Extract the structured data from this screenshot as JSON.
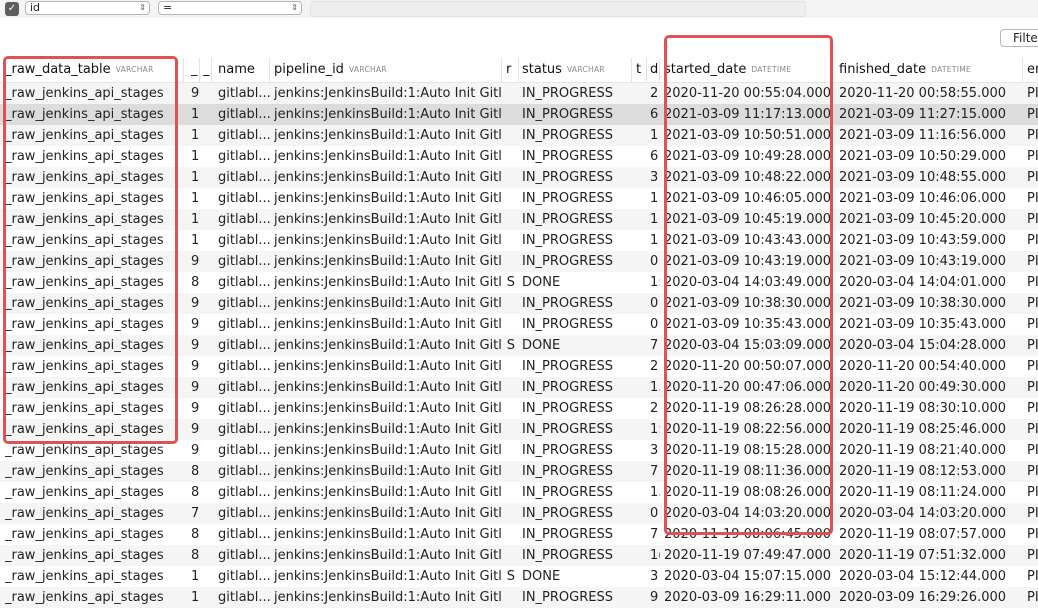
{
  "filter": {
    "field": "id",
    "operator": "=",
    "value": "",
    "filter_button": "Filter",
    "enabled_icon": "checkmark-icon"
  },
  "table": {
    "columns": [
      {
        "name": "_raw_data_table",
        "type": "VARCHAR"
      },
      {
        "name": "_",
        "type": ""
      },
      {
        "name": "_",
        "type": ""
      },
      {
        "name": "name",
        "type": ""
      },
      {
        "name": "pipeline_id",
        "type": "VARCHAR"
      },
      {
        "name": "r",
        "type": ""
      },
      {
        "name": "status",
        "type": "VARCHAR"
      },
      {
        "name": "t",
        "type": ""
      },
      {
        "name": "d",
        "type": ""
      },
      {
        "name": "started_date",
        "type": "DATETIME"
      },
      {
        "name": "finished_date",
        "type": "DATETIME"
      },
      {
        "name": "er",
        "type": ""
      }
    ],
    "selected_row": 1,
    "rows": [
      [
        "_raw_jenkins_api_stages",
        "9",
        "",
        "gitlabl...",
        "jenkins:JenkinsBuild:1:Auto Init Gitl...",
        "",
        "IN_PROGRESS",
        "",
        "2",
        "2020-11-20 00:55:04.000",
        "2020-11-20 00:58:55.000",
        "PI"
      ],
      [
        "_raw_jenkins_api_stages",
        "1(",
        "",
        "gitlabl...",
        "jenkins:JenkinsBuild:1:Auto Init Gitl...",
        "",
        "IN_PROGRESS",
        "",
        "6",
        "2021-03-09 11:17:13.000",
        "2021-03-09 11:27:15.000",
        "PI"
      ],
      [
        "_raw_jenkins_api_stages",
        "1(",
        "",
        "gitlabl...",
        "jenkins:JenkinsBuild:1:Auto Init Gitl...",
        "",
        "IN_PROGRESS",
        "",
        "1!",
        "2021-03-09 10:50:51.000",
        "2021-03-09 11:16:56.000",
        "PI"
      ],
      [
        "_raw_jenkins_api_stages",
        "1(",
        "",
        "gitlabl...",
        "jenkins:JenkinsBuild:1:Auto Init Gitl...",
        "",
        "IN_PROGRESS",
        "",
        "6",
        "2021-03-09 10:49:28.000",
        "2021-03-09 10:50:29.000",
        "PI"
      ],
      [
        "_raw_jenkins_api_stages",
        "1(",
        "",
        "gitlabl...",
        "jenkins:JenkinsBuild:1:Auto Init Gitl...",
        "",
        "IN_PROGRESS",
        "",
        "3",
        "2021-03-09 10:48:22.000",
        "2021-03-09 10:48:55.000",
        "PI"
      ],
      [
        "_raw_jenkins_api_stages",
        "1(",
        "",
        "gitlabl...",
        "jenkins:JenkinsBuild:1:Auto Init Gitl...",
        "",
        "IN_PROGRESS",
        "",
        "1",
        "2021-03-09 10:46:05.000",
        "2021-03-09 10:46:06.000",
        "PI"
      ],
      [
        "_raw_jenkins_api_stages",
        "1(",
        "",
        "gitlabl...",
        "jenkins:JenkinsBuild:1:Auto Init Gitl...",
        "",
        "IN_PROGRESS",
        "",
        "1",
        "2021-03-09 10:45:19.000",
        "2021-03-09 10:45:20.000",
        "PI"
      ],
      [
        "_raw_jenkins_api_stages",
        "1(",
        "",
        "gitlabl...",
        "jenkins:JenkinsBuild:1:Auto Init Gitl...",
        "",
        "IN_PROGRESS",
        "",
        "1",
        "2021-03-09 10:43:43.000",
        "2021-03-09 10:43:59.000",
        "PI"
      ],
      [
        "_raw_jenkins_api_stages",
        "9",
        "",
        "gitlabl...",
        "jenkins:JenkinsBuild:1:Auto Init Gitl...",
        "",
        "IN_PROGRESS",
        "",
        "0",
        "2021-03-09 10:43:19.000",
        "2021-03-09 10:43:19.000",
        "PI"
      ],
      [
        "_raw_jenkins_api_stages",
        "8",
        "",
        "gitlabl...",
        "jenkins:JenkinsBuild:1:Auto Init Gitl...",
        "S",
        "DONE",
        "",
        "1:",
        "2020-03-04 14:03:49.000",
        "2020-03-04 14:04:01.000",
        "PI"
      ],
      [
        "_raw_jenkins_api_stages",
        "9",
        "",
        "gitlabl...",
        "jenkins:JenkinsBuild:1:Auto Init Gitl...",
        "",
        "IN_PROGRESS",
        "",
        "0",
        "2021-03-09 10:38:30.000",
        "2021-03-09 10:38:30.000",
        "PI"
      ],
      [
        "_raw_jenkins_api_stages",
        "9",
        "",
        "gitlabl...",
        "jenkins:JenkinsBuild:1:Auto Init Gitl...",
        "",
        "IN_PROGRESS",
        "",
        "0",
        "2021-03-09 10:35:43.000",
        "2021-03-09 10:35:43.000",
        "PI"
      ],
      [
        "_raw_jenkins_api_stages",
        "9",
        "",
        "gitlabl...",
        "jenkins:JenkinsBuild:1:Auto Init Gitl...",
        "S",
        "DONE",
        "",
        "7",
        "2020-03-04 15:03:09.000",
        "2020-03-04 15:04:28.000",
        "PI"
      ],
      [
        "_raw_jenkins_api_stages",
        "9",
        "",
        "gitlabl...",
        "jenkins:JenkinsBuild:1:Auto Init Gitl...",
        "",
        "IN_PROGRESS",
        "",
        "2",
        "2020-11-20 00:50:07.000",
        "2020-11-20 00:54:40.000",
        "PI"
      ],
      [
        "_raw_jenkins_api_stages",
        "9",
        "",
        "gitlabl...",
        "jenkins:JenkinsBuild:1:Auto Init Gitl...",
        "",
        "IN_PROGRESS",
        "",
        "1.",
        "2020-11-20 00:47:06.000",
        "2020-11-20 00:49:30.000",
        "PI"
      ],
      [
        "_raw_jenkins_api_stages",
        "9",
        "",
        "gitlabl...",
        "jenkins:JenkinsBuild:1:Auto Init Gitl...",
        "",
        "IN_PROGRESS",
        "",
        "2",
        "2020-11-19 08:26:28.000",
        "2020-11-19 08:30:10.000",
        "PI"
      ],
      [
        "_raw_jenkins_api_stages",
        "9",
        "",
        "gitlabl...",
        "jenkins:JenkinsBuild:1:Auto Init Gitl...",
        "",
        "IN_PROGRESS",
        "",
        "1:",
        "2020-11-19 08:22:56.000",
        "2020-11-19 08:25:46.000",
        "PI"
      ],
      [
        "_raw_jenkins_api_stages",
        "9",
        "",
        "gitlabl...",
        "jenkins:JenkinsBuild:1:Auto Init Gitl...",
        "",
        "IN_PROGRESS",
        "",
        "3",
        "2020-11-19 08:15:28.000",
        "2020-11-19 08:21:40.000",
        "PI"
      ],
      [
        "_raw_jenkins_api_stages",
        "8",
        "",
        "gitlabl...",
        "jenkins:JenkinsBuild:1:Auto Init Gitl...",
        "",
        "IN_PROGRESS",
        "",
        "7",
        "2020-11-19 08:11:36.000",
        "2020-11-19 08:12:53.000",
        "PI"
      ],
      [
        "_raw_jenkins_api_stages",
        "8",
        "",
        "gitlabl...",
        "jenkins:JenkinsBuild:1:Auto Init Gitl...",
        "",
        "IN_PROGRESS",
        "",
        "1.",
        "2020-11-19 08:08:26.000",
        "2020-11-19 08:11:24.000",
        "PI"
      ],
      [
        "_raw_jenkins_api_stages",
        "7",
        "",
        "gitlabl...",
        "jenkins:JenkinsBuild:1:Auto Init Gitl...",
        "",
        "IN_PROGRESS",
        "",
        "0",
        "2020-03-04 14:03:20.000",
        "2020-03-04 14:03:20.000",
        "PI"
      ],
      [
        "_raw_jenkins_api_stages",
        "8",
        "",
        "gitlabl...",
        "jenkins:JenkinsBuild:1:Auto Init Gitl...",
        "",
        "IN_PROGRESS",
        "",
        "7",
        "2020-11-19 08:06:45.000",
        "2020-11-19 08:07:57.000",
        "PI"
      ],
      [
        "_raw_jenkins_api_stages",
        "8",
        "",
        "gitlabl...",
        "jenkins:JenkinsBuild:1:Auto Init Gitl...",
        "",
        "IN_PROGRESS",
        "",
        "1(",
        "2020-11-19 07:49:47.000",
        "2020-11-19 07:51:32.000",
        "PI"
      ],
      [
        "_raw_jenkins_api_stages",
        "1(",
        "",
        "gitlabl...",
        "jenkins:JenkinsBuild:1:Auto Init Gitl...",
        "S",
        "DONE",
        "",
        "3",
        "2020-03-04 15:07:15.000",
        "2020-03-04 15:12:44.000",
        "PI"
      ],
      [
        "_raw_jenkins_api_stages",
        "1:",
        "",
        "gitlabl...",
        "jenkins:JenkinsBuild:1:Auto Init Gitl...",
        "",
        "IN_PROGRESS",
        "",
        "9",
        "2020-03-09 16:29:11.000",
        "2020-03-09 16:29:26.000",
        "PI"
      ]
    ]
  },
  "highlight_color": "#e05252"
}
